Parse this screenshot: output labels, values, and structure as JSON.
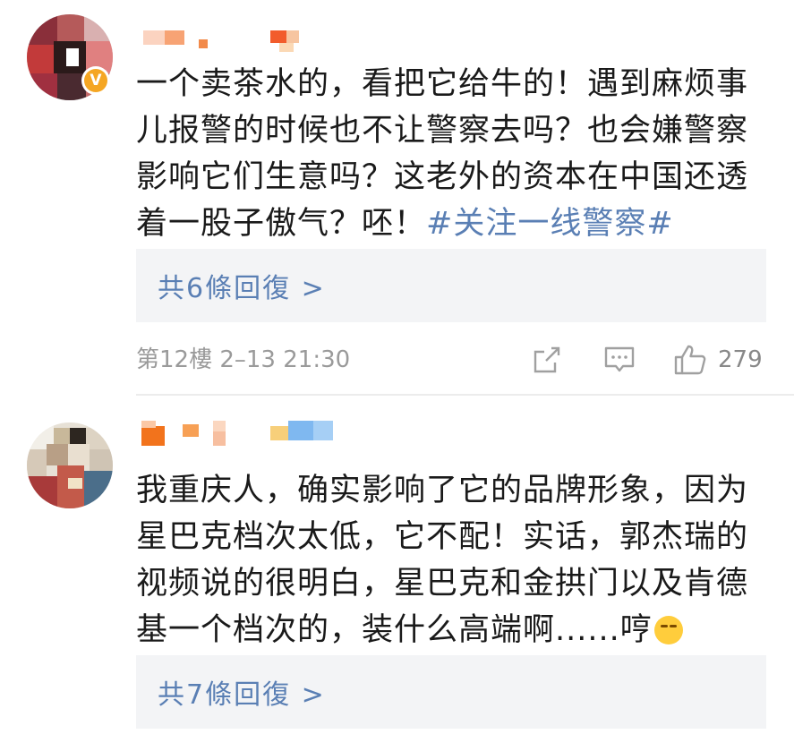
{
  "comments": [
    {
      "text": "一个卖茶水的，看把它给牛的！遇到麻烦事儿报警的时候也不让警察去吗？也会嫌警察影响它们生意吗？这老外的资本在中国还透着一股子傲气？呸！",
      "topic": "#关注一线警察#",
      "replies_label": "共6條回復 >",
      "meta": "第12樓  2–13  21:30",
      "like_count": "279",
      "verified_badge": "V",
      "icons": [
        "share-icon",
        "comment-icon",
        "like-icon"
      ]
    },
    {
      "text": "我重庆人，确实影响了它的品牌形象，因为星巴克档次太低，它不配！实话，郭杰瑞的视频说的很明白，星巴克和金拱门以及肯德基一个档次的，装什么高端啊......哼",
      "emoji": "smirk-emoji-icon",
      "replies_label": "共7條回復 >"
    }
  ],
  "colors": {
    "link": "#5a7fb4",
    "meta": "#9a9a9a",
    "reply_bg": "#f3f4f6",
    "badge": "#f5a623"
  }
}
